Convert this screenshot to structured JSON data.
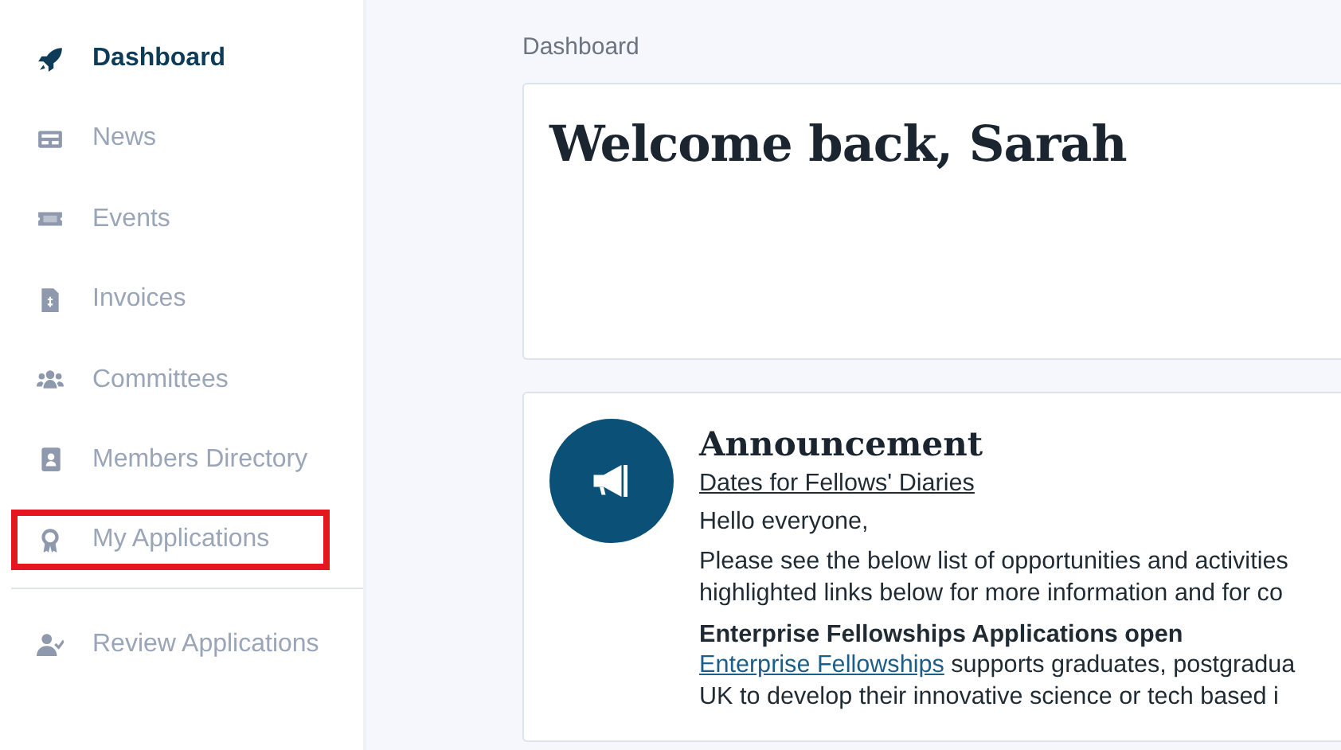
{
  "sidebar": {
    "items": [
      {
        "label": "Dashboard",
        "kind": "rocket",
        "selected": true,
        "highlighted": false
      },
      {
        "label": "News",
        "kind": "news",
        "selected": false,
        "highlighted": false
      },
      {
        "label": "Events",
        "kind": "ticket",
        "selected": false,
        "highlighted": false
      },
      {
        "label": "Invoices",
        "kind": "invoice",
        "selected": false,
        "highlighted": false
      },
      {
        "label": "Committees",
        "kind": "users",
        "selected": false,
        "highlighted": false
      },
      {
        "label": "Members Directory",
        "kind": "contact",
        "selected": false,
        "highlighted": false
      },
      {
        "label": "My Applications",
        "kind": "award",
        "selected": false,
        "highlighted": true
      }
    ],
    "secondary_items": [
      {
        "label": "Review Applications",
        "kind": "user-check",
        "selected": false,
        "highlighted": false
      }
    ]
  },
  "breadcrumb": "Dashboard",
  "welcome": {
    "title": "Welcome back, Sarah"
  },
  "announcement": {
    "title": "Announcement",
    "link": "Dates for Fellows' Diaries",
    "greeting": "Hello everyone,",
    "paragraph_lines": [
      "Please see the below list of opportunities and activities",
      "highlighted links below for more information and for co"
    ],
    "section_title": "Enterprise Fellowships Applications open",
    "section_link": "Enterprise Fellowships",
    "section_text": " supports graduates, postgradua",
    "section_more": "UK to develop their innovative science or tech based i"
  }
}
